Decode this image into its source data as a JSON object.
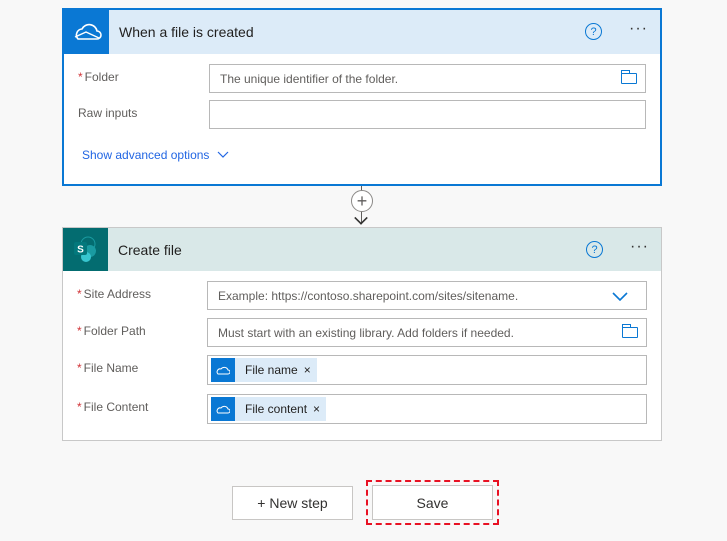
{
  "trigger": {
    "title": "When a file is created",
    "help": "?",
    "more": "···",
    "fields": [
      {
        "label": "Folder",
        "required": true,
        "placeholder": "The unique identifier of the folder."
      },
      {
        "label": "Raw inputs",
        "required": false,
        "placeholder": ""
      }
    ],
    "advanced": "Show advanced options"
  },
  "connector": {
    "plus": "+"
  },
  "action": {
    "title": "Create file",
    "icon_letter": "S",
    "help": "?",
    "more": "···",
    "fields": [
      {
        "label": "Site Address",
        "required": true,
        "placeholder": "Example: https://contoso.sharepoint.com/sites/sitename."
      },
      {
        "label": "Folder Path",
        "required": true,
        "placeholder": "Must start with an existing library. Add folders if needed."
      },
      {
        "label": "File Name",
        "required": true,
        "token": "File name"
      },
      {
        "label": "File Content",
        "required": true,
        "token": "File content"
      }
    ],
    "remove": "×",
    "star": "*"
  },
  "footer": {
    "new_step": "+ New step",
    "save": "Save"
  }
}
